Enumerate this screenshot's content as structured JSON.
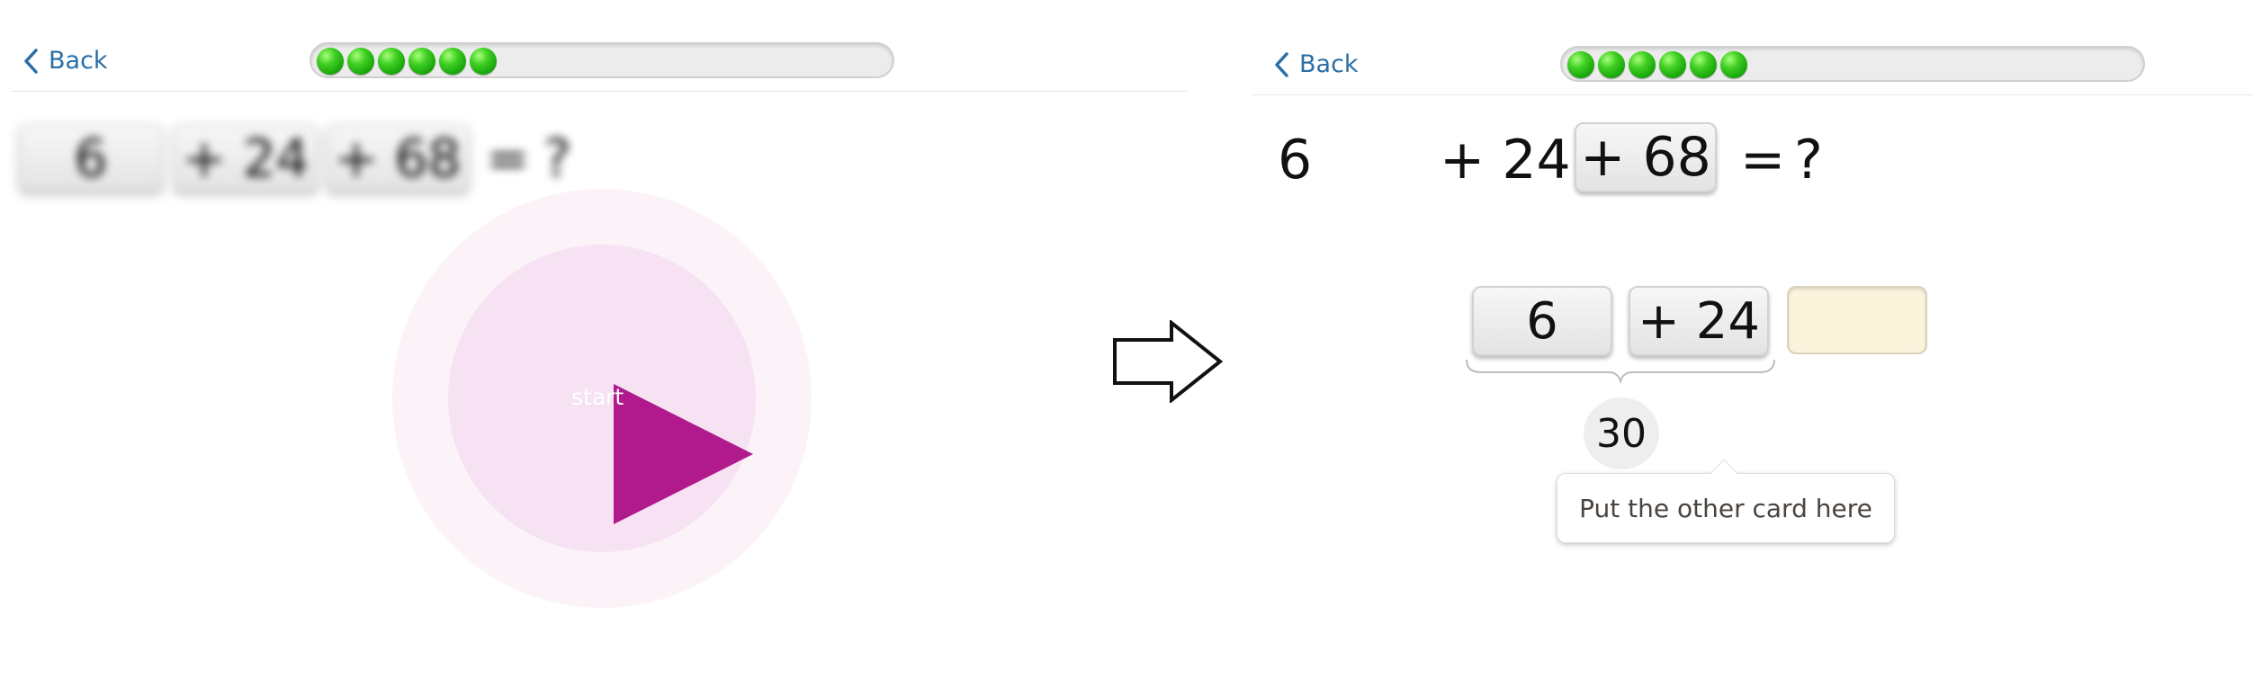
{
  "left_screen": {
    "back_label": "Back",
    "progress": {
      "filled_dots": 6,
      "dot_color": "#2ecc1a"
    },
    "equation": {
      "card1": "6",
      "card2": "+ 24",
      "card3": "+ 68",
      "equals": "=",
      "unknown": "?"
    },
    "start_label": "start",
    "start_color": "#b01a8c"
  },
  "right_screen": {
    "back_label": "Back",
    "progress": {
      "filled_dots": 6,
      "dot_color": "#2ecc1a"
    },
    "equation": {
      "term1": "6",
      "term2": "+ 24",
      "card3": "+ 68",
      "equals": "=",
      "unknown": "?"
    },
    "workspace": {
      "card1": "6",
      "card2": "+ 24",
      "partial_sum": "30",
      "hint": "Put the other card here"
    }
  },
  "colors": {
    "link_blue": "#2a6ea6",
    "slot_fill": "#fbf3dc"
  }
}
